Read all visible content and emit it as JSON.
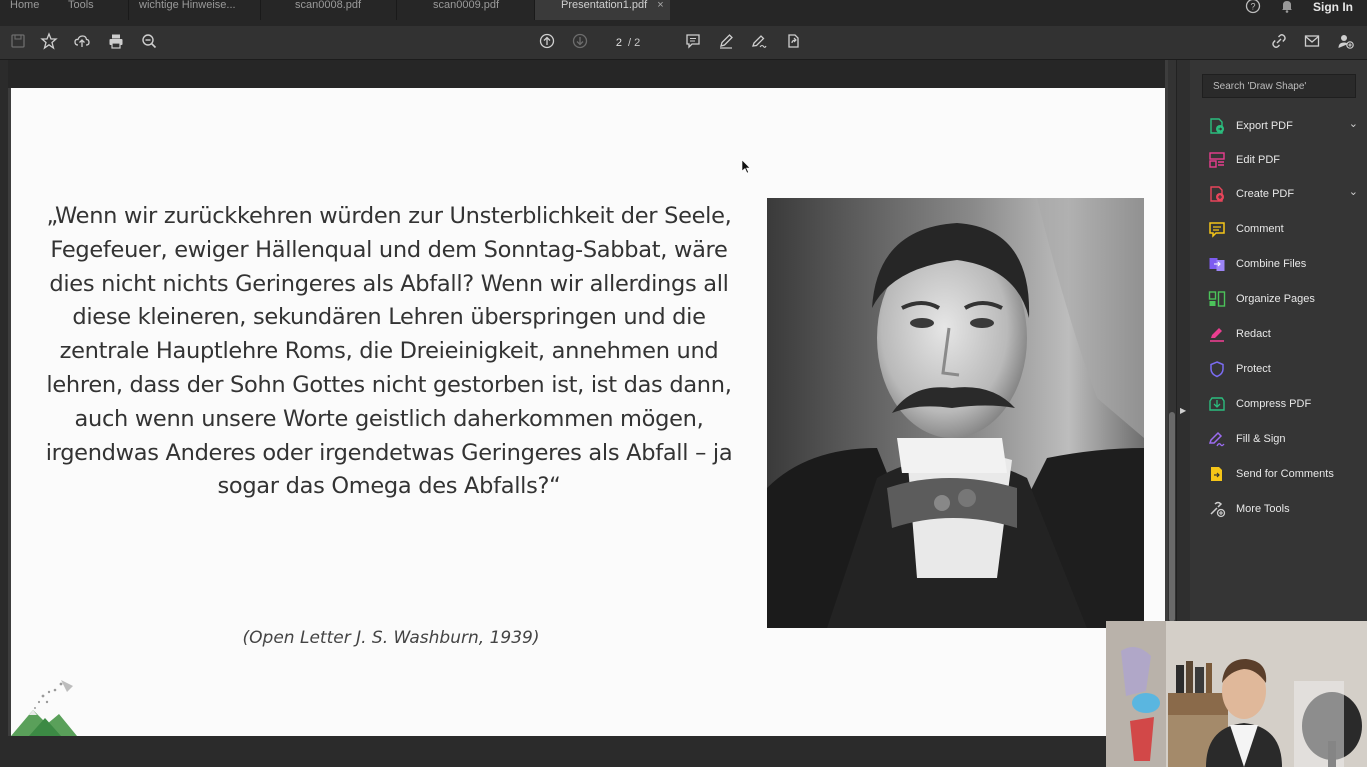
{
  "tabs": [
    {
      "label": "Home"
    },
    {
      "label": "Tools"
    },
    {
      "label": "wichtige Hinweise..."
    },
    {
      "label": "scan0008.pdf"
    },
    {
      "label": "scan0009.pdf"
    },
    {
      "label": "Presentation1.pdf",
      "close": "×"
    }
  ],
  "header": {
    "sign_in": "Sign In"
  },
  "toolbar": {
    "left_icons": [
      "save-icon",
      "bookmark-star-icon",
      "upload-cloud-icon",
      "print-icon",
      "zoom-out-icon"
    ],
    "nav_icons": [
      "page-up-icon",
      "page-down-icon"
    ],
    "current_page": "2",
    "total_pages": "/ 2",
    "tool_icons": [
      "comment-icon",
      "highlight-pen-icon",
      "sign-icon",
      "share-icon"
    ],
    "right_icons": [
      "link-icon",
      "mail-icon",
      "add-user-icon"
    ]
  },
  "slide": {
    "quote": "„Wenn wir zurückkehren würden zur Unsterblichkeit der Seele, Fegefeuer, ewiger Hällenqual und dem Sonntag-Sabbat, wäre dies nicht nichts Geringeres als Abfall? Wenn wir allerdings all diese kleineren, sekundären Lehren überspringen und die zentrale Hauptlehre Roms, die Dreieinigkeit, annehmen und lehren, dass der Sohn Gottes nicht gestorben ist, ist das dann, auch wenn unsere Worte geistlich daherkommen mögen, irgendwas Anderes oder irgendetwas Geringeres als Abfall – ja sogar das Omega des Abfalls?“",
    "citation": "(Open Letter J. S. Washburn, 1939)"
  },
  "panel": {
    "search_placeholder": "Search 'Draw Shape'",
    "tools": [
      {
        "label": "Export PDF",
        "icon": "export-pdf-icon",
        "color": "#2bbd7e",
        "expandable": true
      },
      {
        "label": "Edit PDF",
        "icon": "edit-pdf-icon",
        "color": "#ea3e8f",
        "expandable": false
      },
      {
        "label": "Create PDF",
        "icon": "create-pdf-icon",
        "color": "#e9455b",
        "expandable": true
      },
      {
        "label": "Comment",
        "icon": "comment-icon",
        "color": "#f5c518",
        "expandable": false
      },
      {
        "label": "Combine Files",
        "icon": "combine-files-icon",
        "color": "#7d5cf0",
        "expandable": false
      },
      {
        "label": "Organize Pages",
        "icon": "organize-pages-icon",
        "color": "#4cc35a",
        "expandable": false
      },
      {
        "label": "Redact",
        "icon": "redact-icon",
        "color": "#ea3e8f",
        "expandable": false
      },
      {
        "label": "Protect",
        "icon": "protect-icon",
        "color": "#7b6cf2",
        "expandable": false
      },
      {
        "label": "Compress PDF",
        "icon": "compress-pdf-icon",
        "color": "#2bbd7e",
        "expandable": false
      },
      {
        "label": "Fill & Sign",
        "icon": "fill-sign-icon",
        "color": "#9b6cf0",
        "expandable": false
      },
      {
        "label": "Send for Comments",
        "icon": "send-for-comments-icon",
        "color": "#f5c518",
        "expandable": false
      },
      {
        "label": "More Tools",
        "icon": "more-tools-icon",
        "color": "#cfcfcf",
        "expandable": false
      }
    ]
  }
}
